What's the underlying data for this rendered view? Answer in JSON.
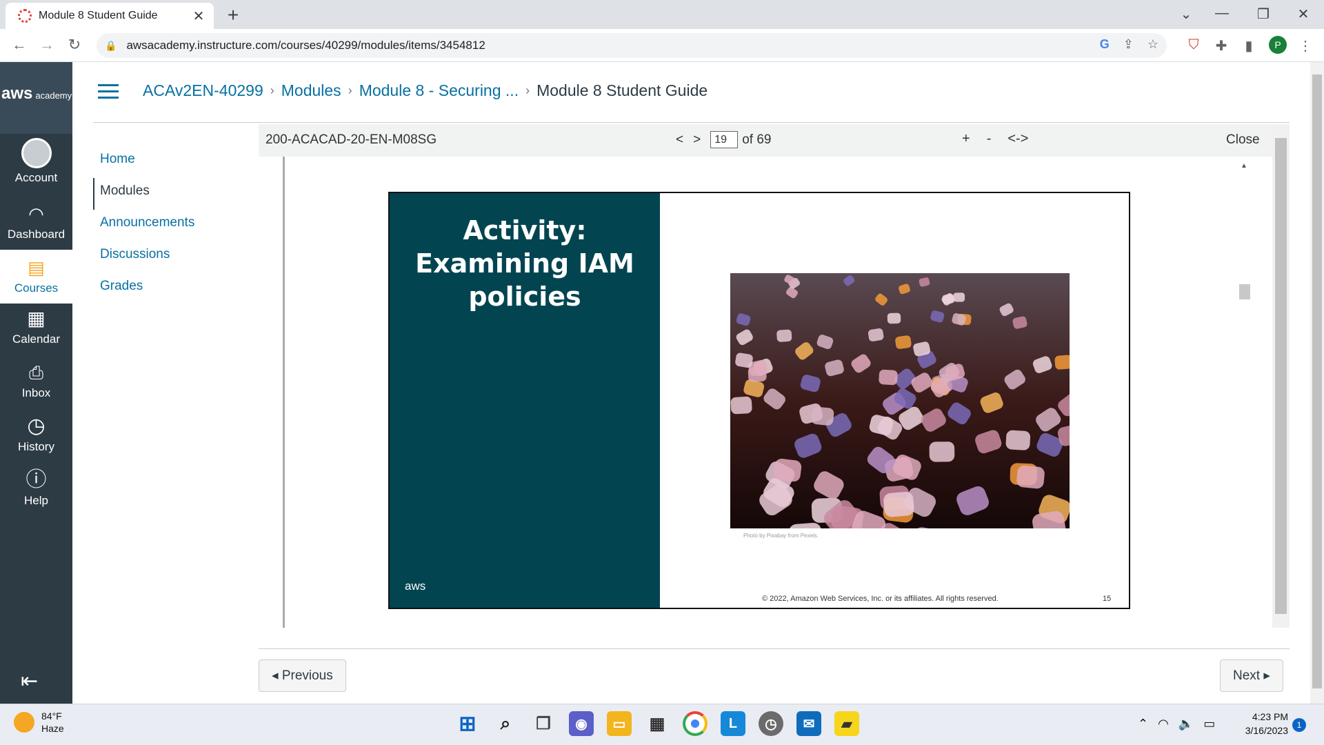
{
  "browser": {
    "tab_title": "Module 8 Student Guide",
    "new_tab": "+",
    "url": "awsacademy.instructure.com/courses/40299/modules/items/3454812",
    "profile_initial": "P"
  },
  "global_nav": {
    "logo_aws": "aws",
    "logo_academy": "academy",
    "items": [
      {
        "label": "Account",
        "icon": "user-icon"
      },
      {
        "label": "Dashboard",
        "icon": "dashboard-icon"
      },
      {
        "label": "Courses",
        "icon": "courses-icon"
      },
      {
        "label": "Calendar",
        "icon": "calendar-icon"
      },
      {
        "label": "Inbox",
        "icon": "inbox-icon"
      },
      {
        "label": "History",
        "icon": "clock-icon"
      },
      {
        "label": "Help",
        "icon": "help-icon"
      }
    ]
  },
  "breadcrumb": {
    "course": "ACAv2EN-40299",
    "modules": "Modules",
    "module": "Module 8 - Securing ...",
    "current": "Module 8 Student Guide"
  },
  "course_nav": [
    "Home",
    "Modules",
    "Announcements",
    "Discussions",
    "Grades"
  ],
  "viewer": {
    "doc_name": "200-ACACAD-20-EN-M08SG",
    "prev": "<",
    "next": ">",
    "page": "19",
    "of_total": "of 69",
    "zoom_in": "+",
    "zoom_out": "-",
    "fit": "<->",
    "close": "Close"
  },
  "slide": {
    "title_line1": "Activity:",
    "title_line2": "Examining IAM",
    "title_line3": "policies",
    "logo": "aws",
    "photo_credit": "Photo by Pixabay from Pexels.",
    "copyright": "© 2022, Amazon Web Services, Inc. or its affiliates. All rights reserved.",
    "page_number": "15"
  },
  "footer": {
    "previous": "◂ Previous",
    "next": "Next ▸"
  },
  "taskbar": {
    "temp": "84°F",
    "condition": "Haze",
    "time": "4:23 PM",
    "date": "3/16/2023",
    "notifications": "1"
  },
  "colors": {
    "canvas_nav": "#2d3b45",
    "link": "#0770a3",
    "slide_panel": "#024551"
  }
}
